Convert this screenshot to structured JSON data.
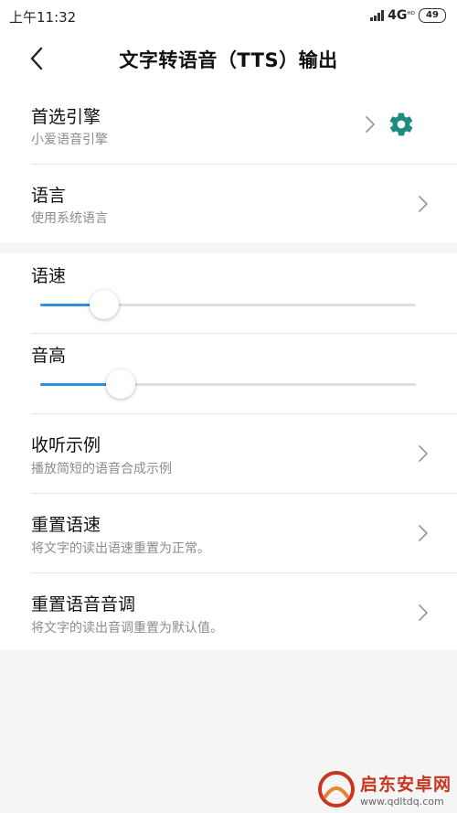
{
  "status_bar": {
    "time": "上午11:32",
    "network": "4G",
    "network_sub": "ᴴᴰ",
    "battery": "49"
  },
  "header": {
    "title": "文字转语音（TTS）输出"
  },
  "settings": {
    "preferred_engine": {
      "title": "首选引擎",
      "subtitle": "小爱语音引擎"
    },
    "language": {
      "title": "语言",
      "subtitle": "使用系统语言"
    },
    "speech_rate": {
      "title": "语速",
      "value": 0.17
    },
    "pitch": {
      "title": "音高",
      "value": 0.215
    },
    "listen_example": {
      "title": "收听示例",
      "subtitle": "播放简短的语音合成示例"
    },
    "reset_rate": {
      "title": "重置语速",
      "subtitle": "将文字的读出语速重置为正常。"
    },
    "reset_pitch": {
      "title": "重置语音音调",
      "subtitle": "将文字的读出音调重置为默认值。"
    }
  },
  "colors": {
    "accent": "#2f8fe0",
    "gear": "#1e8a80"
  },
  "watermark": {
    "name": "启东安卓网",
    "url": "www.qdltdq.com"
  }
}
